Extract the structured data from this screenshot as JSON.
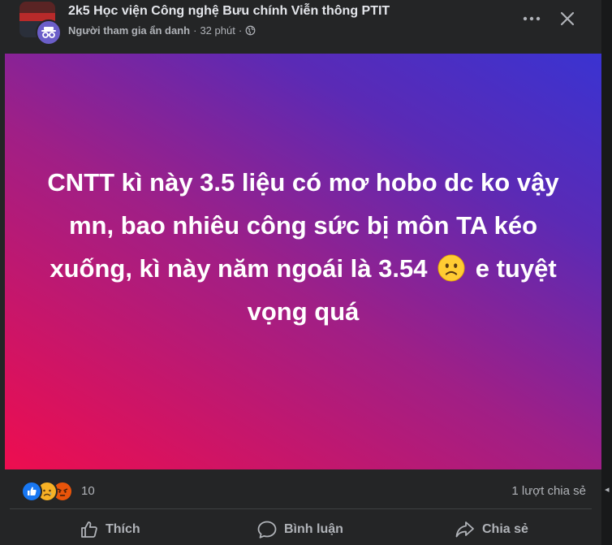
{
  "header": {
    "group_name": "2k5 Học viện Công nghệ Bưu chính Viễn thông PTIT",
    "author": "Người tham gia ẩn danh",
    "separator": "·",
    "time": "32 phút",
    "privacy_icon": "globe-icon",
    "more_icon": "more-horizontal-icon",
    "close_icon": "close-icon"
  },
  "post": {
    "text_before_emoji": "CNTT kì này 3.5 liệu có mơ hobo dc ko vậy mn, bao nhiêu công sức bị môn TA kéo xuống, kì này năm ngoái là 3.54",
    "emoji_icon": "slightly-frowning-face-icon",
    "text_after_emoji": "e tuyệt vọng quá",
    "background_colors": [
      "#ee0d4f",
      "#a01f86",
      "#5b2ab5",
      "#3a33d1"
    ]
  },
  "stats": {
    "reaction_icons": [
      "like-icon",
      "sad-icon",
      "angry-icon"
    ],
    "reaction_count": "10",
    "share_count": "1 lượt chia sẻ"
  },
  "actions": {
    "like": "Thích",
    "comment": "Bình luận",
    "share": "Chia sẻ"
  },
  "colors": {
    "card_bg": "#242526",
    "text_primary": "#e4e6eb",
    "text_secondary": "#b0b3b8",
    "like_blue": "#1877f2"
  }
}
